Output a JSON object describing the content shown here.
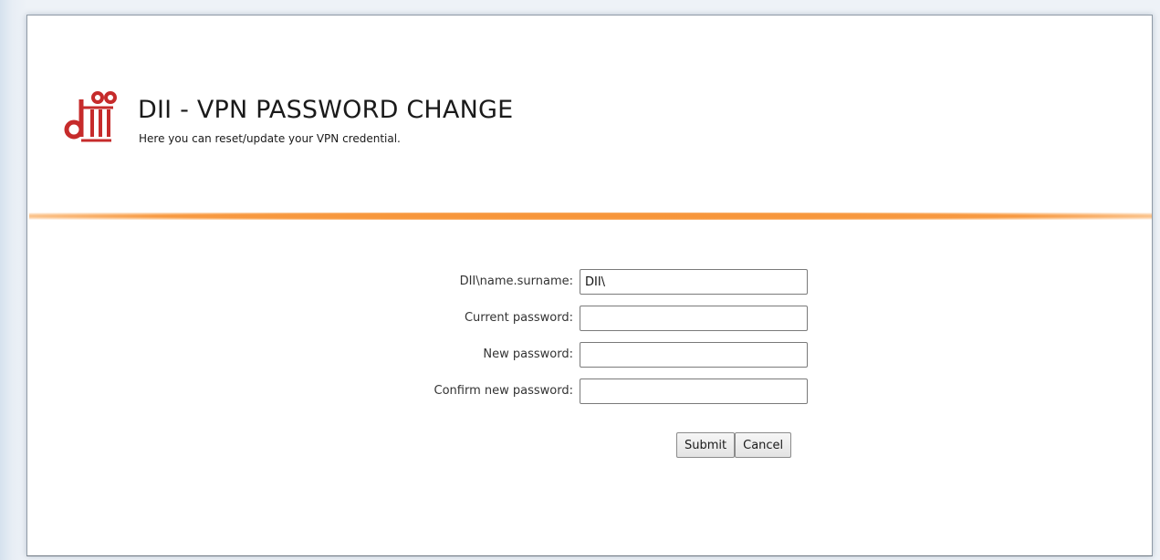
{
  "header": {
    "title": "DII - VPN PASSWORD CHANGE",
    "subtitle": "Here you can reset/update your VPN credential."
  },
  "colors": {
    "logo_red": "#c62b2b",
    "divider_orange": "#f79437"
  },
  "icons": {
    "logo": "dii-logo-icon"
  },
  "form": {
    "username": {
      "label": "DII\\name.surname:",
      "value": "DII\\"
    },
    "current_password": {
      "label": "Current password:",
      "value": ""
    },
    "new_password": {
      "label": "New password:",
      "value": ""
    },
    "confirm_password": {
      "label": "Confirm new password:",
      "value": ""
    },
    "submit_label": "Submit",
    "cancel_label": "Cancel"
  }
}
